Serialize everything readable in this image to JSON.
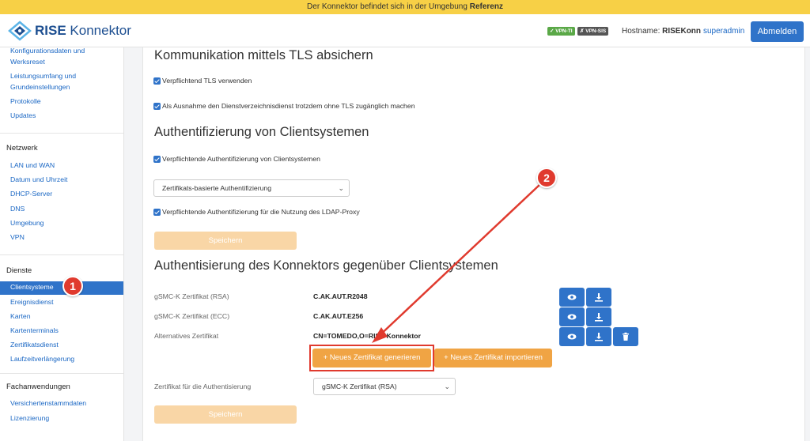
{
  "banner": {
    "prefix": "Der Konnektor befindet sich in der Umgebung",
    "env": "Referenz"
  },
  "header": {
    "logo_bold": "RISE",
    "logo_rest": "Konnektor",
    "badges": [
      "✓ VPN-TI",
      "✗ VPN-SIS"
    ],
    "hostname_label": "Hostname:",
    "hostname_value": "RISEKonn",
    "user": "superadmin",
    "logout": "Abmelden"
  },
  "sidebar": {
    "top_links": [
      "Konfigurationsdaten und Werksreset",
      "Leistungsumfang und Grundeinstellungen",
      "Protokolle",
      "Updates"
    ],
    "netzwerk": {
      "heading": "Netzwerk",
      "links": [
        "LAN und WAN",
        "Datum und Uhrzeit",
        "DHCP-Server",
        "DNS",
        "Umgebung",
        "VPN"
      ]
    },
    "dienste": {
      "heading": "Dienste",
      "active": "Clientsysteme",
      "links": [
        "Ereignisdienst",
        "Karten",
        "Kartenterminals",
        "Zertifikatsdienst",
        "Laufzeitverlängerung"
      ]
    },
    "fachanwendungen": {
      "heading": "Fachanwendungen",
      "links": [
        "Versichertenstammdaten",
        "Lizenzierung"
      ]
    }
  },
  "tls": {
    "title": "Kommunikation mittels TLS absichern",
    "check1": "Verpflichtend TLS verwenden",
    "check2": "Als Ausnahme den Dienstverzeichnisdienst trotzdem ohne TLS zugänglich machen"
  },
  "auth": {
    "title": "Authentifizierung von Clientsystemen",
    "check1": "Verpflichtende Authentifizierung von Clientsystemen",
    "method_select": "Zertifikats-basierte Authentifizierung",
    "check2": "Verpflichtende Authentifizierung für die Nutzung des LDAP-Proxy",
    "save": "Speichern"
  },
  "konnektor_auth": {
    "title": "Authentisierung des Konnektors gegenüber Clientsystemen",
    "rows": [
      {
        "label": "gSMC-K Zertifikat (RSA)",
        "value": "C.AK.AUT.R2048"
      },
      {
        "label": "gSMC-K Zertifikat (ECC)",
        "value": "C.AK.AUT.E256"
      },
      {
        "label": "Alternatives Zertifikat",
        "value": "CN=TOMEDO,O=RISE Konnektor"
      }
    ],
    "generate_btn": "+ Neues Zertifikat generieren",
    "import_btn": "+ Neues Zertifikat importieren",
    "auth_cert_label": "Zertifikat für die Authentisierung",
    "auth_cert_select": "gSMC-K Zertifikat (RSA)",
    "save": "Speichern"
  },
  "annotations": {
    "marker1": "1",
    "marker2": "2",
    "accent": "#e03a2e"
  },
  "colors": {
    "primary": "#2f73c9",
    "orange": "#f0a444",
    "banner": "#f7d046"
  }
}
